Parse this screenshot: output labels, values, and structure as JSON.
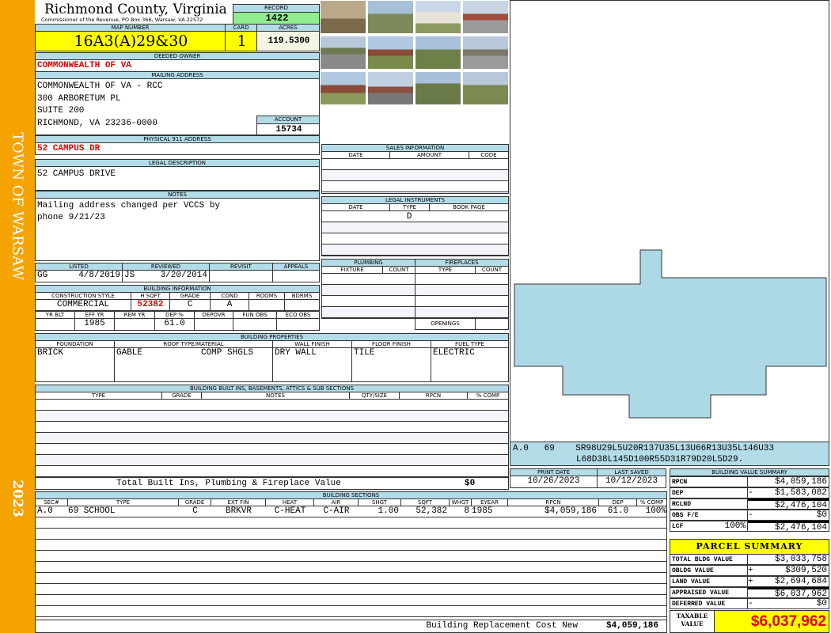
{
  "sidebar": {
    "town": "TOWN OF WARSAW",
    "year": "2023"
  },
  "header": {
    "county": "Richmond County, Virginia",
    "office": "Commissioner of the Revenue, PO Box 366, Warsaw, VA 22572",
    "record_label": "RECORD",
    "record": "1422"
  },
  "parcel": {
    "map_label": "MAP NUMBER",
    "map": "16A3(A)29&30",
    "card_label": "CARD",
    "card": "1",
    "acres_label": "ACRES",
    "acres": "119.5300"
  },
  "owner": {
    "label": "DEEDED OWNER",
    "name": "COMMONWEALTH OF VA"
  },
  "mailing": {
    "label": "MAILING ADDRESS",
    "lines": [
      "COMMONWEALTH OF VA - RCC",
      "300 ARBORETUM PL",
      "SUITE 200",
      "RICHMOND, VA 23236-0000"
    ],
    "account_label": "ACCOUNT",
    "account": "15734"
  },
  "physical": {
    "label": "PHYSICAL 911 ADDRESS",
    "value": "52 CAMPUS DR"
  },
  "legal": {
    "label": "LEGAL DESCRIPTION",
    "value": "52 CAMPUS DRIVE"
  },
  "notes": {
    "label": "NOTES",
    "line1": "Mailing address changed per VCCS by",
    "line2": "phone 9/21/23"
  },
  "listing": {
    "listed_label": "LISTED",
    "listed_by": "GG",
    "listed_date": "4/8/2019",
    "reviewed_label": "REVIEWED",
    "reviewed_by": "JS",
    "reviewed_date": "3/20/2014",
    "revisit_label": "REVISIT",
    "appeals_label": "APPEALS"
  },
  "building_info": {
    "label": "BUILDING INFORMATION",
    "h1": [
      "CONSTRUCTION STYLE",
      "H SQFT",
      "GRADE",
      "COND",
      "ROOMS",
      "BDRMS"
    ],
    "v1": [
      "COMMERCIAL",
      "52382",
      "C",
      "A",
      "",
      ""
    ],
    "h2": [
      "YR BLT",
      "EFF YR",
      "REM YR",
      "DEP %",
      "DEPOVR",
      "FUN OBS",
      "ECO OBS"
    ],
    "v2": [
      "",
      "1985",
      "",
      "61.0",
      "",
      "",
      ""
    ]
  },
  "building_props": {
    "label": "BUILDING PROPERTIES",
    "headers": [
      "FOUNDATION",
      "ROOF TYPE/MATERIAL",
      "WALL FINISH",
      "FLOOR FINISH",
      "FUEL TYPE"
    ],
    "foundation": "BRICK",
    "roof_type": "GABLE",
    "roof_material": "COMP SHGLS",
    "wall": "DRY WALL",
    "floor": "TILE",
    "fuel": "ELECTRIC"
  },
  "built_ins": {
    "label": "BUILDING BUILT INS, BASEMENTS, ATTICS & SUB SECTIONS",
    "headers": [
      "TYPE",
      "GRADE",
      "NOTES",
      "QTY/SIZE",
      "RPCN",
      "% COMP"
    ],
    "total_label": "Total Built Ins, Plumbing & Fireplace Value",
    "total": "$0"
  },
  "sales": {
    "label": "SALES INFORMATION",
    "headers": [
      "DATE",
      "AMOUNT",
      "CODE"
    ]
  },
  "instruments": {
    "label": "LEGAL INSTRUMENTS",
    "headers": [
      "DATE",
      "TYPE",
      "BOOK PAGE"
    ],
    "row1_type": "D"
  },
  "plumbing": {
    "label": "PLUMBING",
    "headers": [
      "FIXTURE",
      "COUNT"
    ]
  },
  "fireplaces": {
    "label": "FIREPLACES",
    "headers": [
      "TYPE",
      "COUNT"
    ],
    "openings_label": "OPENINGS"
  },
  "sketch": {
    "code_line1": "A.0   69    SR98U29L5U20R137U35L13U66R13U35L146U33",
    "code_line2": "L68D38L145D100R55D31R79D20L5D29."
  },
  "dates": {
    "print_label": "PRINT DATE",
    "print": "10/26/2023",
    "saved_label": "LAST SAVED",
    "saved": "10/12/2023"
  },
  "sections": {
    "label": "BUILDING SECTIONS",
    "headers": [
      "SEC#",
      "TYPE",
      "GRADE",
      "EXT FIN",
      "HEAT",
      "AIR",
      "SHGT",
      "SQFT",
      "WHGT",
      "EYEAR",
      "RPCN",
      "DEP",
      "% COMP"
    ],
    "rows": [
      [
        "A.0",
        "69 SCHOOL",
        "C",
        "BRKVR",
        "C-HEAT",
        "C-AIR",
        "1.00",
        "52,382",
        "8",
        "1985",
        "$4,059,186",
        "61.0",
        "100%"
      ]
    ],
    "footer_label": "Building Replacement Cost New",
    "footer_value": "$4,059,186"
  },
  "value_summary": {
    "label": "BUILDING VALUE SUMMARY",
    "rows": [
      {
        "label": "RPCN",
        "sign": "",
        "value": "$4,059,186"
      },
      {
        "label": "DEP",
        "sign": "-",
        "value": "$1,583,082"
      },
      {
        "label": "RCLND",
        "sign": "",
        "value": "$2,476,104"
      },
      {
        "label": "OBS F/E",
        "sign": "-",
        "value": "$0"
      },
      {
        "label": "LCF",
        "pct": "100%",
        "sign": "",
        "value": "$2,476,104"
      }
    ]
  },
  "parcel_summary": {
    "label": "PARCEL SUMMARY",
    "rows": [
      {
        "label": "TOTAL BLDG VALUE",
        "sign": "",
        "value": "$3,033,758"
      },
      {
        "label": "OBLDG VALUE",
        "sign": "+",
        "value": "$309,520"
      },
      {
        "label": "LAND VALUE",
        "sign": "+",
        "value": "$2,694,684"
      },
      {
        "label": "APPRAISED VALUE",
        "sign": "",
        "value": "$6,037,962"
      },
      {
        "label": "DEFERRED VALUE",
        "sign": "-",
        "value": "$0"
      }
    ],
    "taxable_label": "TAXABLE VALUE",
    "taxable": "$6,037,962"
  },
  "colors": {
    "sidebar": "#f5a300",
    "header_band": "#b3dbe8",
    "highlight": "#ffff00",
    "record": "#90ee90",
    "red": "#e00000"
  }
}
